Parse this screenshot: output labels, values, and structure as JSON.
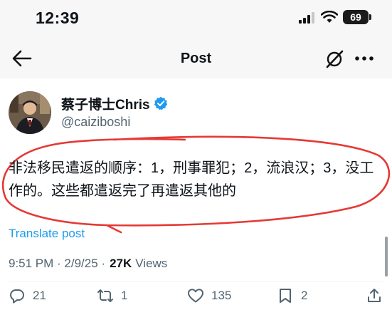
{
  "status_bar": {
    "time": "12:39",
    "battery": "69"
  },
  "nav": {
    "title": "Post"
  },
  "author": {
    "name": "蔡子博士Chris",
    "handle": "@caiziboshi"
  },
  "tweet": {
    "text": "非法移民遣返的顺序：1，刑事罪犯；2，流浪汉；3，没工作的。这些都遣返完了再遣返其他的",
    "translate_label": "Translate post"
  },
  "meta": {
    "time_date": "9:51 PM · 2/9/25 · ",
    "views_count": "27K",
    "views_label": "Views"
  },
  "actions": {
    "replies": "21",
    "reposts": "1",
    "likes": "135",
    "bookmarks": "2"
  },
  "colors": {
    "accent": "#1d9bf0",
    "annotation": "#e53935",
    "muted": "#536471"
  }
}
